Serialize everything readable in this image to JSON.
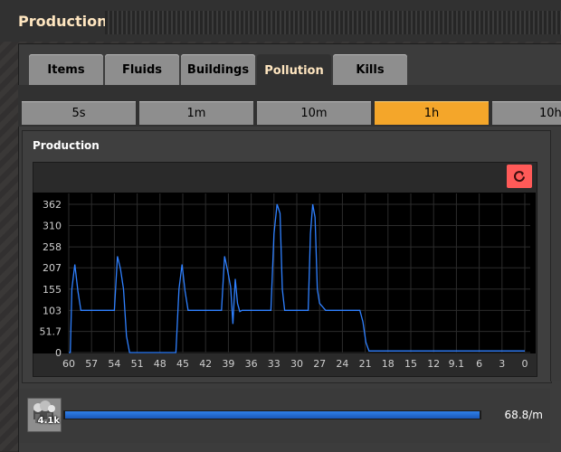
{
  "window": {
    "title": "Production"
  },
  "tabs": [
    {
      "label": "Items",
      "active": false
    },
    {
      "label": "Fluids",
      "active": false
    },
    {
      "label": "Buildings",
      "active": false
    },
    {
      "label": "Pollution",
      "active": true
    },
    {
      "label": "Kills",
      "active": false
    }
  ],
  "time_ranges": [
    {
      "label": "5s",
      "active": false
    },
    {
      "label": "1m",
      "active": false
    },
    {
      "label": "10m",
      "active": false
    },
    {
      "label": "1h",
      "active": true
    },
    {
      "label": "10h",
      "active": false
    }
  ],
  "panel": {
    "title": "Production",
    "reset_icon": "reset-icon"
  },
  "colors": {
    "accent": "#f4a62a",
    "series": "#2f80ff",
    "reset": "#ff5a58"
  },
  "chart_data": {
    "type": "line",
    "ylim": [
      0,
      362
    ],
    "yticks": [
      "0",
      "51.7",
      "103",
      "155",
      "207",
      "258",
      "310",
      "362"
    ],
    "xticks": [
      "60",
      "57",
      "54",
      "51",
      "48",
      "45",
      "42",
      "39",
      "36",
      "33",
      "30",
      "27",
      "24",
      "21",
      "18",
      "15",
      "12",
      "9.1",
      "6",
      "3",
      "0"
    ],
    "xlim": [
      60,
      0
    ],
    "series": [
      {
        "x": [
          60,
          59.8,
          59.6,
          59.2,
          58.8,
          58.4,
          58.0,
          57.6,
          57.4,
          54.0,
          53.6,
          53.2,
          52.8,
          52.4,
          52.0,
          51.9,
          45.9,
          45.5,
          45.1,
          44.7,
          44.3,
          43.9,
          43.5,
          39.9,
          39.5,
          39.1,
          38.7,
          38.4,
          38.1,
          37.8,
          37.5,
          37.2,
          36.9,
          36.6,
          36.3,
          36.0,
          33.8,
          33.4,
          33.0,
          32.6,
          32.2,
          31.9,
          31.6,
          31.3,
          30.1,
          29.7,
          29.4,
          29.1,
          28.8,
          28.5,
          28.2,
          27.9,
          27.6,
          27.3,
          27.0,
          26.2,
          25.9,
          25.5,
          25.1,
          22.1,
          21.7,
          21.3,
          20.9,
          20.5,
          20.1,
          0
        ],
        "values": [
          0,
          0,
          155,
          215,
          150,
          103,
          103,
          103,
          103,
          103,
          235,
          205,
          155,
          40,
          0,
          0,
          0,
          155,
          215,
          150,
          103,
          103,
          103,
          103,
          235,
          200,
          160,
          70,
          180,
          120,
          100,
          103,
          103,
          103,
          103,
          103,
          103,
          103,
          290,
          362,
          340,
          155,
          103,
          103,
          103,
          103,
          103,
          103,
          103,
          103,
          290,
          362,
          330,
          155,
          120,
          103,
          103,
          103,
          103,
          103,
          103,
          75,
          25,
          4,
          4,
          4
        ]
      }
    ]
  },
  "row": {
    "item_count": "4.1k",
    "rate": "68.8/m",
    "bar_fill": 1.0,
    "icon": "pollution-icon"
  }
}
